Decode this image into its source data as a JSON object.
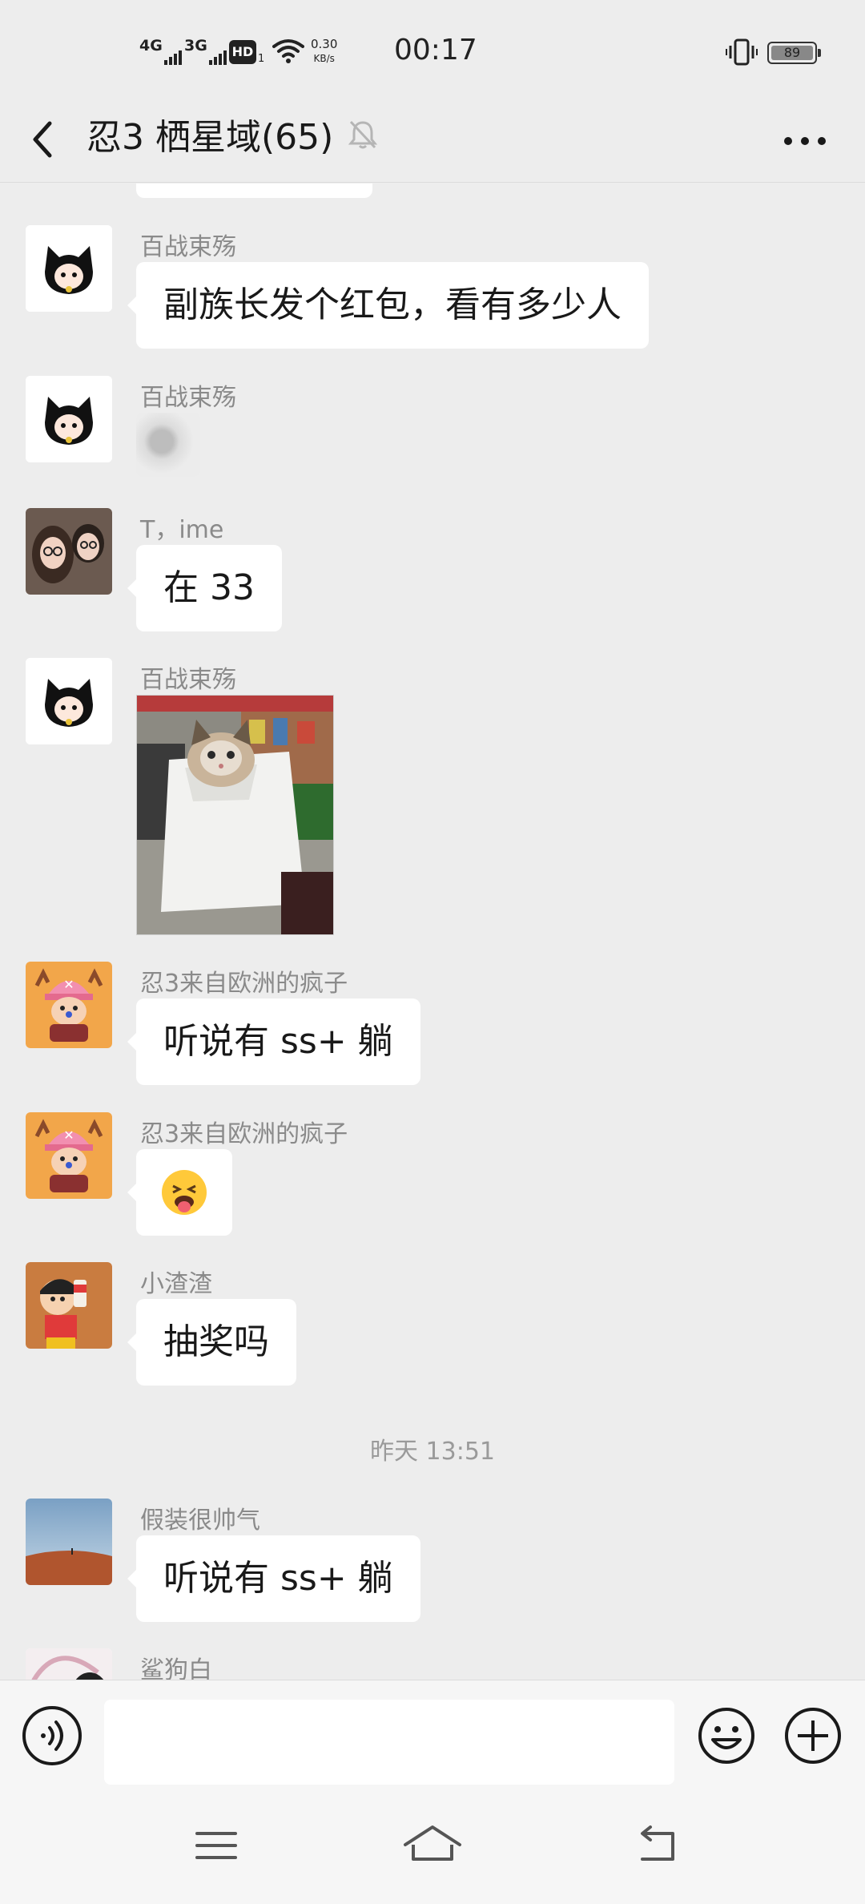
{
  "status_bar": {
    "network_1": "4G",
    "network_2": "3G",
    "hd_label": "HD",
    "hd_sub": "1",
    "speed_value": "0.30",
    "speed_unit": "KB/s",
    "time": "00:17",
    "battery_level": "89"
  },
  "header": {
    "title": "忍3 栖星域(65)",
    "icons": {
      "back": "chevron-left-icon",
      "mute": "bell-muted-icon",
      "more": "more-dots-icon"
    }
  },
  "messages": [
    {
      "sender": "百战束殇",
      "type": "text",
      "text": "副族长发个红包，看有多少人",
      "avatar": "black-cat-girl-avatar"
    },
    {
      "sender": "百战束殇",
      "type": "sticker",
      "avatar": "black-cat-girl-avatar"
    },
    {
      "sender": "T，ime",
      "type": "text",
      "text": "在 33",
      "avatar": "couple-selfie-avatar"
    },
    {
      "sender": "百战束殇",
      "type": "image",
      "avatar": "black-cat-girl-avatar"
    },
    {
      "sender": "忍3来自欧洲的疯子",
      "type": "text",
      "text": "听说有 ss+ 躺",
      "avatar": "chopper-avatar"
    },
    {
      "sender": "忍3来自欧洲的疯子",
      "type": "emoji",
      "text": "😜",
      "avatar": "chopper-avatar"
    },
    {
      "sender": "小渣渣",
      "type": "text",
      "text": "抽奖吗",
      "avatar": "crayon-shin-chan-avatar"
    },
    {
      "sender": "假装很帅气",
      "type": "text",
      "text": "听说有 ss+ 躺",
      "avatar": "desert-landscape-avatar"
    },
    {
      "sender": "鲨狗白",
      "type": "partial",
      "avatar": "partial-avatar"
    }
  ],
  "timestamp": "昨天 13:51",
  "input_bar": {
    "placeholder": "",
    "icons": {
      "voice": "voice-icon",
      "emoji": "emoji-icon",
      "plus": "plus-icon"
    }
  },
  "nav_bar": {
    "icons": {
      "menu": "menu-icon",
      "home": "home-icon",
      "back": "back-icon"
    }
  }
}
